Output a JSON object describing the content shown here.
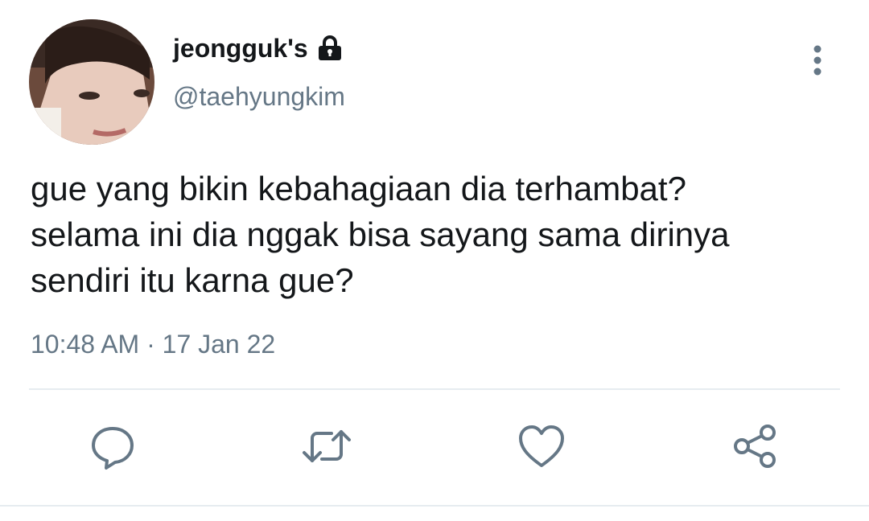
{
  "user": {
    "display_name": "jeongguk's",
    "handle": "@taehyungkim",
    "protected": true,
    "avatar": "profile-photo"
  },
  "tweet": {
    "lines": [
      "gue yang bikin kebahagiaan dia terhambat?",
      "selama ini dia nggak bisa sayang sama dirinya",
      "sendiri itu karna gue?"
    ],
    "timestamp": "10:48 AM · 17 Jan 22"
  },
  "actions": {
    "icons": [
      "reply-icon",
      "retweet-icon",
      "like-icon",
      "share-icon"
    ]
  },
  "colors": {
    "text": "#14171a",
    "secondary": "#657786",
    "divider": "#e6ecf0"
  }
}
